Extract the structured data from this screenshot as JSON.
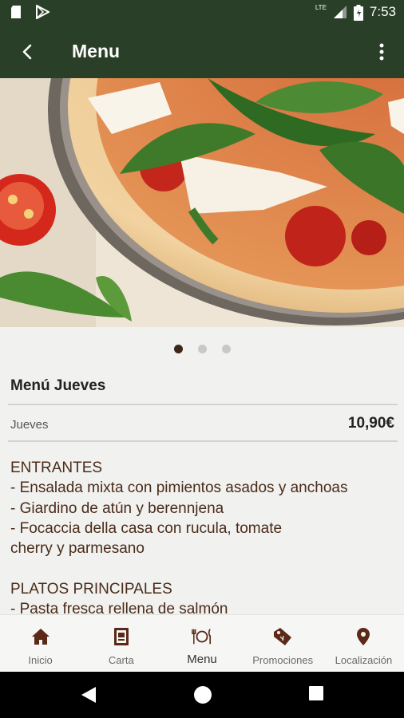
{
  "status_bar": {
    "time": "7:53",
    "network": "LTE",
    "icons": [
      "sd-card-icon",
      "play-store-icon",
      "signal-icon",
      "battery-icon"
    ]
  },
  "app_bar": {
    "title": "Menu",
    "back_icon": "arrow-back-icon",
    "overflow_icon": "more-vert-icon"
  },
  "carousel": {
    "image": "pizza-photo",
    "page_count": 3,
    "active_index": 0
  },
  "menu": {
    "title": "Menú Jueves",
    "price_label": "Jueves",
    "price": "10,90€",
    "lines": [
      "ENTRANTES",
      "- Ensalada mixta con pimientos asados y anchoas",
      "- Giardino de atún y berennjena",
      "- Focaccia della casa con rucula, tomate",
      "cherry y parmesano",
      "",
      "PLATOS PRINCIPALES",
      "- Pasta fresca rellena de salmón"
    ]
  },
  "bottom_nav": {
    "items": [
      {
        "label": "Inicio",
        "icon": "home-icon"
      },
      {
        "label": "Carta",
        "icon": "menu-card-icon"
      },
      {
        "label": "Menu",
        "icon": "dish-cutlery-icon"
      },
      {
        "label": "Promociones",
        "icon": "tags-icon"
      },
      {
        "label": "Localización",
        "icon": "location-pin-icon"
      }
    ],
    "active_index": 2
  },
  "colors": {
    "app_bar": "#2a3f27",
    "accent": "#5a2a17",
    "text_brown": "#4a2c1a",
    "background": "#f1f1ef"
  }
}
